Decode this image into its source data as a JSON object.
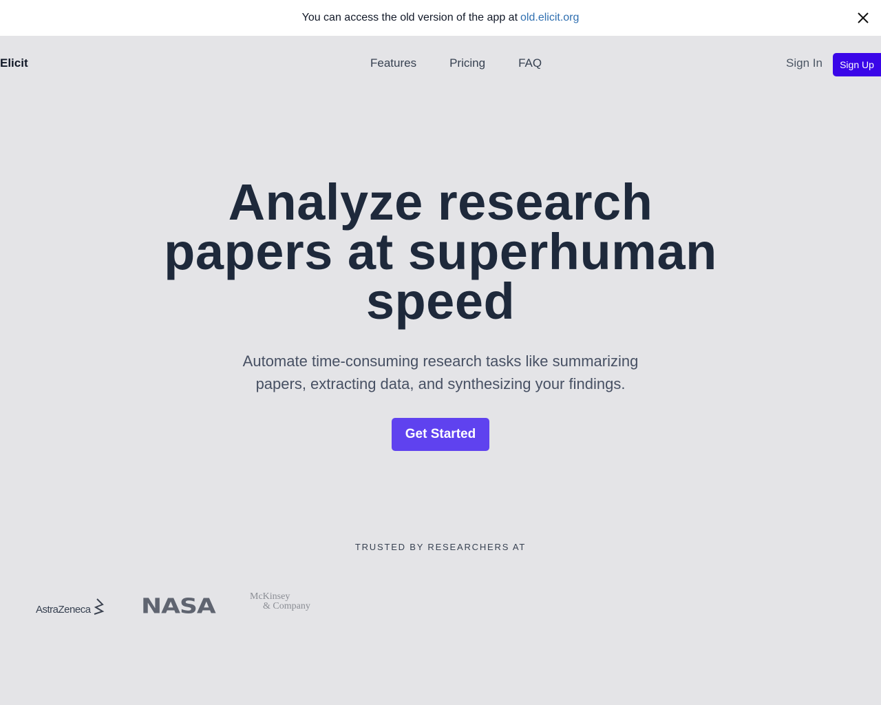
{
  "banner": {
    "message": "You can access the old version of the app at",
    "link_text": "old.elicit.org",
    "close_icon": "close-icon"
  },
  "nav": {
    "logo": "Elicit",
    "links": [
      {
        "label": "Features"
      },
      {
        "label": "Pricing"
      },
      {
        "label": "FAQ"
      }
    ],
    "sign_in": "Sign In",
    "sign_up": "Sign Up"
  },
  "hero": {
    "title_lines": [
      "Analyze research",
      "papers at superhuman",
      "speed"
    ],
    "subtitle_lines": [
      "Automate time-consuming research tasks like summarizing",
      "papers, extracting data, and synthesizing your findings."
    ],
    "cta": "Get Started"
  },
  "trusted": {
    "heading": "TRUSTED BY RESEARCHERS AT",
    "logos": [
      {
        "name": "AstraZeneca"
      },
      {
        "name": "NASA"
      },
      {
        "name_line1": "McKinsey",
        "name_line2": "& Company"
      }
    ]
  },
  "colors": {
    "accent": "#5f42ef",
    "signup": "#3a06e8",
    "link": "#2f6fb0",
    "background": "#e4e4e7"
  }
}
